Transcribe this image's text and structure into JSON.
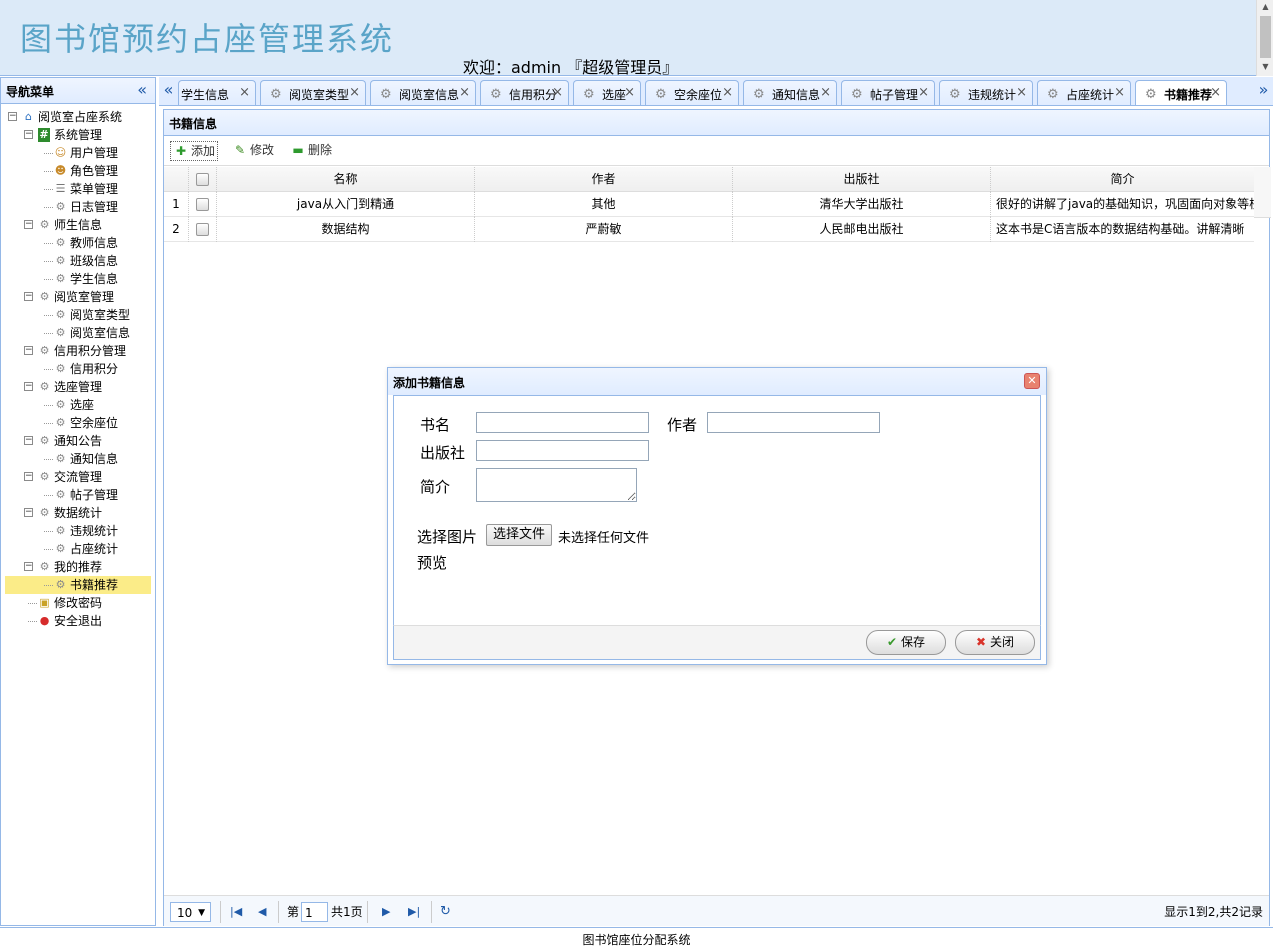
{
  "header": {
    "system_title": "图书馆预约占座管理系统",
    "welcome": "欢迎：admin 『超级管理员』"
  },
  "nav": {
    "title": "导航菜单",
    "collapse_icon": "double-chevron-left-icon",
    "items": [
      {
        "label": "阅览室占座系统",
        "level": 0,
        "icon": "home-icon"
      },
      {
        "label": "系统管理",
        "level": 1,
        "icon": "hash-icon"
      },
      {
        "label": "用户管理",
        "level": 2,
        "icon": "user-icon"
      },
      {
        "label": "角色管理",
        "level": 2,
        "icon": "group-icon"
      },
      {
        "label": "菜单管理",
        "level": 2,
        "icon": "menu-icon"
      },
      {
        "label": "日志管理",
        "level": 2,
        "icon": "gear-icon"
      },
      {
        "label": "师生信息",
        "level": 1,
        "icon": "gear-icon"
      },
      {
        "label": "教师信息",
        "level": 2,
        "icon": "gear-icon"
      },
      {
        "label": "班级信息",
        "level": 2,
        "icon": "gear-icon"
      },
      {
        "label": "学生信息",
        "level": 2,
        "icon": "gear-icon"
      },
      {
        "label": "阅览室管理",
        "level": 1,
        "icon": "gear-icon"
      },
      {
        "label": "阅览室类型",
        "level": 2,
        "icon": "gear-icon"
      },
      {
        "label": "阅览室信息",
        "level": 2,
        "icon": "gear-icon"
      },
      {
        "label": "信用积分管理",
        "level": 1,
        "icon": "gear-icon"
      },
      {
        "label": "信用积分",
        "level": 2,
        "icon": "gear-icon"
      },
      {
        "label": "选座管理",
        "level": 1,
        "icon": "gear-icon"
      },
      {
        "label": "选座",
        "level": 2,
        "icon": "gear-icon"
      },
      {
        "label": "空余座位",
        "level": 2,
        "icon": "gear-icon"
      },
      {
        "label": "通知公告",
        "level": 1,
        "icon": "gear-icon"
      },
      {
        "label": "通知信息",
        "level": 2,
        "icon": "gear-icon"
      },
      {
        "label": "交流管理",
        "level": 1,
        "icon": "gear-icon"
      },
      {
        "label": "帖子管理",
        "level": 2,
        "icon": "gear-icon"
      },
      {
        "label": "数据统计",
        "level": 1,
        "icon": "gear-icon"
      },
      {
        "label": "违规统计",
        "level": 2,
        "icon": "gear-icon"
      },
      {
        "label": "占座统计",
        "level": 2,
        "icon": "gear-icon"
      },
      {
        "label": "我的推荐",
        "level": 1,
        "icon": "gear-icon"
      },
      {
        "label": "书籍推荐",
        "level": 2,
        "icon": "gear-icon",
        "selected": true
      },
      {
        "label": "修改密码",
        "level": 1,
        "icon": "lock-icon"
      },
      {
        "label": "安全退出",
        "level": 1,
        "icon": "exit-icon"
      }
    ]
  },
  "tabs": {
    "scroll_left": "«",
    "scroll_right": "»",
    "items": [
      {
        "label": "学生信息"
      },
      {
        "label": "阅览室类型"
      },
      {
        "label": "阅览室信息"
      },
      {
        "label": "信用积分"
      },
      {
        "label": "选座"
      },
      {
        "label": "空余座位"
      },
      {
        "label": "通知信息"
      },
      {
        "label": "帖子管理"
      },
      {
        "label": "违规统计"
      },
      {
        "label": "占座统计"
      },
      {
        "label": "书籍推荐",
        "active": true
      }
    ]
  },
  "panel": {
    "title": "书籍信息"
  },
  "toolbar": {
    "add_label": "添加",
    "edit_label": "修改",
    "delete_label": "删除"
  },
  "grid": {
    "columns": [
      "名称",
      "作者",
      "出版社",
      "简介"
    ],
    "rows": [
      {
        "num": "1",
        "name": "java从入门到精通",
        "author": "其他",
        "publisher": "清华大学出版社",
        "intro": "很好的讲解了java的基础知识，巩固面向对象等核心"
      },
      {
        "num": "2",
        "name": "数据结构",
        "author": "严蔚敏",
        "publisher": "人民邮电出版社",
        "intro": "这本书是C语言版本的数据结构基础。讲解清晰"
      }
    ]
  },
  "pager": {
    "page_size": "10",
    "page_prefix": "第",
    "page_number": "1",
    "page_total": "共1页",
    "summary": "显示1到2,共2记录"
  },
  "footer": {
    "text": "图书馆座位分配系统"
  },
  "dialog": {
    "title": "添加书籍信息",
    "fields": {
      "book_name_label": "书名",
      "author_label": "作者",
      "publisher_label": "出版社",
      "intro_label": "简介",
      "image_label": "选择图片",
      "file_button": "选择文件",
      "file_status": "未选择任何文件",
      "preview_label": "预览"
    },
    "save_label": "保存",
    "close_label": "关闭"
  }
}
